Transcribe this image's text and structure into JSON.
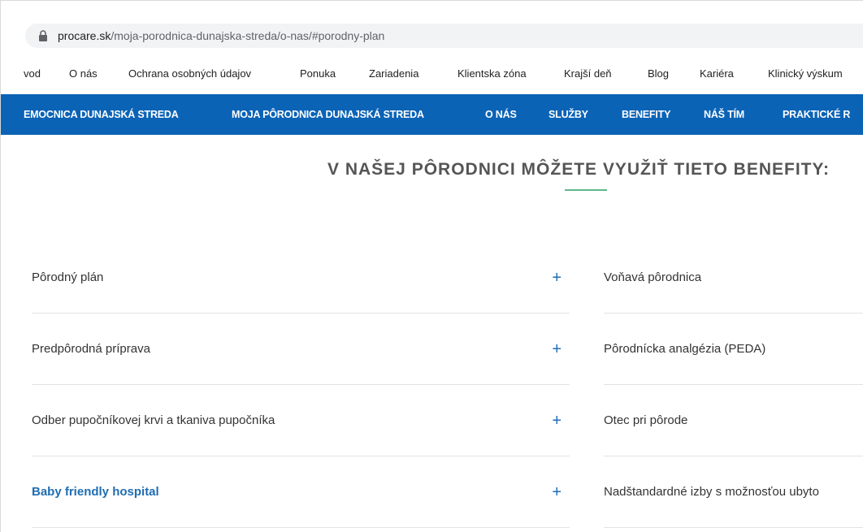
{
  "browser": {
    "url_domain": "procare.sk",
    "url_path": "/moja-porodnica-dunajska-streda/o-nas/#porodny-plan"
  },
  "top_nav": {
    "items": [
      "vod",
      "O nás",
      "Ochrana osobných údajov",
      "Ponuka",
      "Zariadenia",
      "Klientska zóna",
      "Krajší deň",
      "Blog",
      "Kariéra",
      "Klinický výskum"
    ]
  },
  "main_nav": {
    "items": [
      "EMOCNICA DUNAJSKÁ STREDA",
      "MOJA PÔRODNICA DUNAJSKÁ STREDA",
      "O NÁS",
      "SLUŽBY",
      "BENEFITY",
      "NÁŠ TÍM",
      "PRAKTICKÉ R"
    ]
  },
  "section": {
    "heading": "V NAŠEJ PÔRODNICI MÔŽETE VYUŽIŤ TIETO BENEFITY:"
  },
  "benefits_left": [
    {
      "label": "Pôrodný plán"
    },
    {
      "label": "Predpôrodná príprava"
    },
    {
      "label": "Odber pupočníkovej krvi a tkaniva pupočníka"
    },
    {
      "label": "Baby friendly hospital"
    }
  ],
  "benefits_right": [
    {
      "label": "Voňavá pôrodnica"
    },
    {
      "label": "Pôrodnícka analgézia (PEDA)"
    },
    {
      "label": "Otec pri pôrode"
    },
    {
      "label": "Nadštandardné izby s možnosťou ubyto"
    }
  ],
  "expand_symbol": "+",
  "colors": {
    "accent_blue": "#0b63b6",
    "link_blue": "#1f6db3",
    "underline_green": "#5fb88a"
  }
}
